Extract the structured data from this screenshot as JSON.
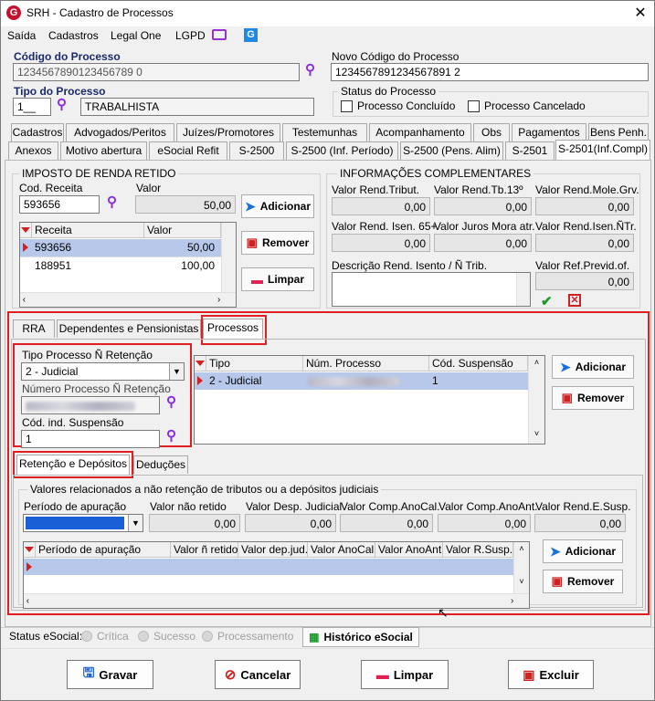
{
  "window": {
    "title": "SRH - Cadastro de Processos",
    "logo": "G",
    "close": "✕"
  },
  "menu": [
    "Saída",
    "Cadastros",
    "Legal One",
    "LGPD"
  ],
  "codigo": {
    "label": "Código do Processo",
    "value": "1234567890123456789 0"
  },
  "novo": {
    "label": "Novo Código do Processo",
    "value": "1234567891234567891 2"
  },
  "tipo": {
    "label": "Tipo do Processo",
    "code": "1__",
    "desc": "TRABALHISTA"
  },
  "status": {
    "label": "Status do Processo",
    "concluido": "Processo Concluído",
    "cancelado": "Processo Cancelado"
  },
  "tabs_row1": [
    "Cadastros",
    "Advogados/Peritos",
    "Juízes/Promotores",
    "Testemunhas",
    "Acompanhamento",
    "Obs",
    "Pagamentos",
    "Bens Penh."
  ],
  "tabs_row2": [
    "Anexos",
    "Motivo abertura",
    "eSocial Refit",
    "S-2500",
    "S-2500 (Inf. Período)",
    "S-2500 (Pens. Alim)",
    "S-2501",
    "S-2501(Inf.Compl)"
  ],
  "irrf": {
    "title": "IMPOSTO DE RENDA RETIDO",
    "cod_label": "Cod. Receita",
    "cod_value": "593656",
    "valor_label": "Valor",
    "valor_value": "50,00",
    "grid_headers": [
      "Receita",
      "Valor"
    ],
    "rows": [
      [
        "593656",
        "50,00"
      ],
      [
        "188951",
        "100,00"
      ]
    ]
  },
  "buttons": {
    "adicionar": "Adicionar",
    "remover": "Remover",
    "limpar": "Limpar"
  },
  "info": {
    "title": "INFORMAÇÕES COMPLEMENTARES",
    "row1": [
      {
        "l": "Valor Rend.Tribut.",
        "v": "0,00"
      },
      {
        "l": "Valor Rend.Tb.13º",
        "v": "0,00"
      },
      {
        "l": "Valor Rend.Mole.Grv.",
        "v": "0,00"
      }
    ],
    "row2": [
      {
        "l": "Valor Rend. Isen. 65+",
        "v": "0,00"
      },
      {
        "l": "Valor Juros Mora atr.",
        "v": "0,00"
      },
      {
        "l": "Valor Rend.Isen.ÑTr.",
        "v": "0,00"
      }
    ],
    "desc_label": "Descrição Rend. Isento / Ñ Trib.",
    "refprev_label": "Valor Ref.Previd.of.",
    "refprev_value": "0,00"
  },
  "subtabs": [
    "RRA",
    "Dependentes e Pensionistas",
    "Processos"
  ],
  "proc": {
    "tipo_label": "Tipo Processo Ñ Retenção",
    "tipo_value": "2 - Judicial",
    "num_label": "Número Processo Ñ Retenção",
    "susp_label": "Cód. ind. Suspensão",
    "susp_value": "1",
    "grid_headers": [
      "Tipo",
      "Núm. Processo",
      "Cód. Suspensão"
    ],
    "row": [
      "2 - Judicial",
      "1"
    ]
  },
  "subtabs2": [
    "Retenção e Depósitos",
    "Deduções"
  ],
  "ret": {
    "title": "Valores relacionados a não retenção de tributos ou a depósitos judiciais",
    "periodo_label": "Período de apuração",
    "fields": [
      {
        "l": "Valor não retido",
        "v": "0,00"
      },
      {
        "l": "Valor Desp. Judicial",
        "v": "0,00"
      },
      {
        "l": "Valor Comp.AnoCal.",
        "v": "0,00"
      },
      {
        "l": "Valor Comp.AnoAnt.",
        "v": "0,00"
      },
      {
        "l": "Valor Rend.E.Susp.",
        "v": "0,00"
      }
    ],
    "grid_headers": [
      "Período de apuração",
      "Valor ñ retido",
      "Valor dep.jud.",
      "Valor AnoCal.",
      "Valor AnoAnt.",
      "Valor R.Susp."
    ]
  },
  "statusbar": {
    "label": "Status eSocial:",
    "critica": "Crítica",
    "sucesso": "Sucesso",
    "processamento": "Processamento",
    "historico": "Histórico eSocial"
  },
  "footer": {
    "gravar": "Gravar",
    "cancelar": "Cancelar",
    "limpar": "Limpar",
    "excluir": "Excluir"
  }
}
